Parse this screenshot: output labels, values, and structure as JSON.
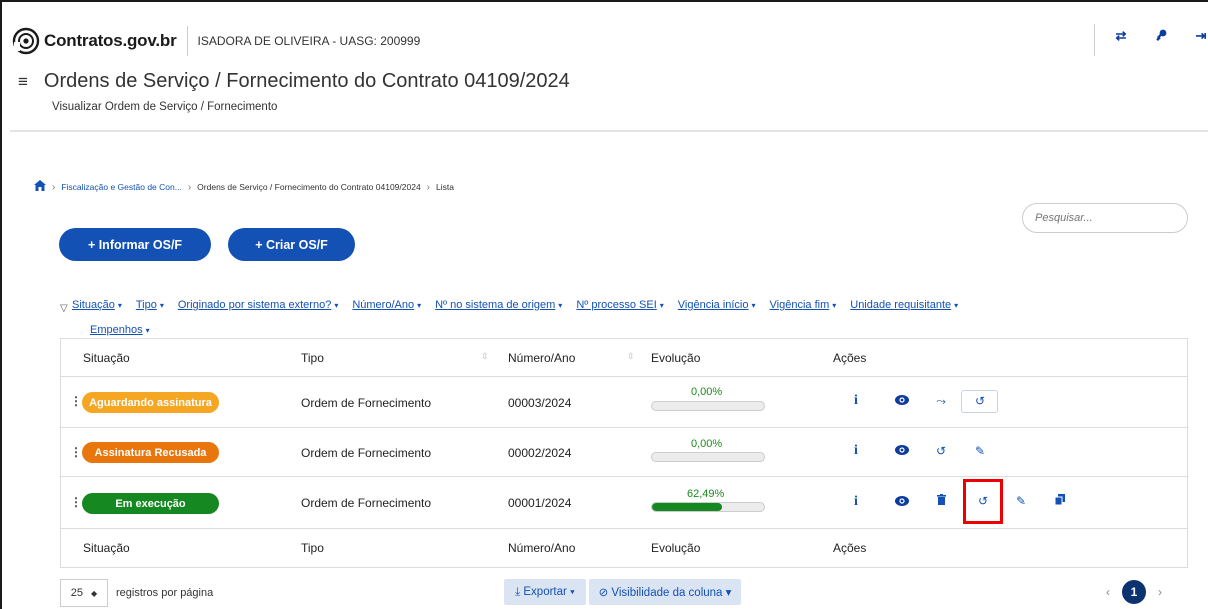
{
  "header": {
    "brand": "Contratos.gov.br",
    "user_info": "ISADORA DE OLIVEIRA - UASG: 200999",
    "icons": [
      "swap-icon",
      "key-icon",
      "logout-icon"
    ]
  },
  "page": {
    "title": "Ordens de Serviço / Fornecimento do Contrato 04109/2024",
    "subtitle": "Visualizar Ordem de Serviço / Fornecimento"
  },
  "breadcrumb": {
    "items": [
      "Fiscalização e Gestão de Con...",
      "Ordens de Serviço / Fornecimento do Contrato 04109/2024",
      "Lista"
    ]
  },
  "search": {
    "placeholder": "Pesquisar..."
  },
  "buttons": {
    "informar": "+ Informar OS/F",
    "criar": "+ Criar OS/F"
  },
  "filters": [
    "Situação",
    "Tipo",
    "Originado por sistema externo?",
    "Número/Ano",
    "Nº no sistema de origem",
    "Nº processo SEI",
    "Vigência início",
    "Vigência fim",
    "Unidade requisitante",
    "Empenhos"
  ],
  "table": {
    "columns": [
      "Situação",
      "Tipo",
      "Número/Ano",
      "Evolução",
      "Ações"
    ],
    "rows": [
      {
        "status": "Aguardando assinatura",
        "status_color": "#f5a623",
        "tipo": "Ordem de Fornecimento",
        "numero": "00003/2024",
        "evolucao": "0,00%",
        "progress": 0
      },
      {
        "status": "Assinatura Recusada",
        "status_color": "#e8760d",
        "tipo": "Ordem de Fornecimento",
        "numero": "00002/2024",
        "evolucao": "0,00%",
        "progress": 0
      },
      {
        "status": "Em execução",
        "status_color": "#168821",
        "tipo": "Ordem de Fornecimento",
        "numero": "00001/2024",
        "evolucao": "62,49%",
        "progress": 62.49
      }
    ]
  },
  "footer": {
    "per_page": "25",
    "per_page_label": "registros por página",
    "export": "⤓ Exportar ▾",
    "visibility": "⊘ Visibilidade da coluna ▾",
    "current_page": "1",
    "prev": "‹",
    "next": "›"
  },
  "colors": {
    "primary": "#1351b4",
    "success": "#168821",
    "highlight": "#e00000"
  }
}
